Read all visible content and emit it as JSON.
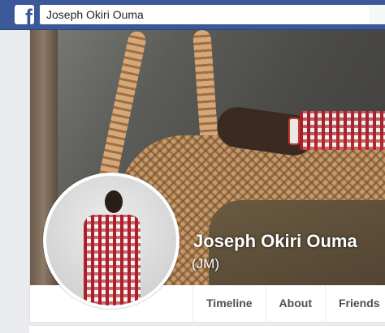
{
  "header": {
    "logo_letter": "f",
    "search_value": "Joseph Okiri Ouma",
    "brand_color": "#3b5998"
  },
  "profile": {
    "name": "Joseph Okiri Ouma",
    "alternate_name": "(JM)"
  },
  "tabs": [
    {
      "label": "Timeline"
    },
    {
      "label": "About"
    },
    {
      "label": "Friends"
    }
  ]
}
